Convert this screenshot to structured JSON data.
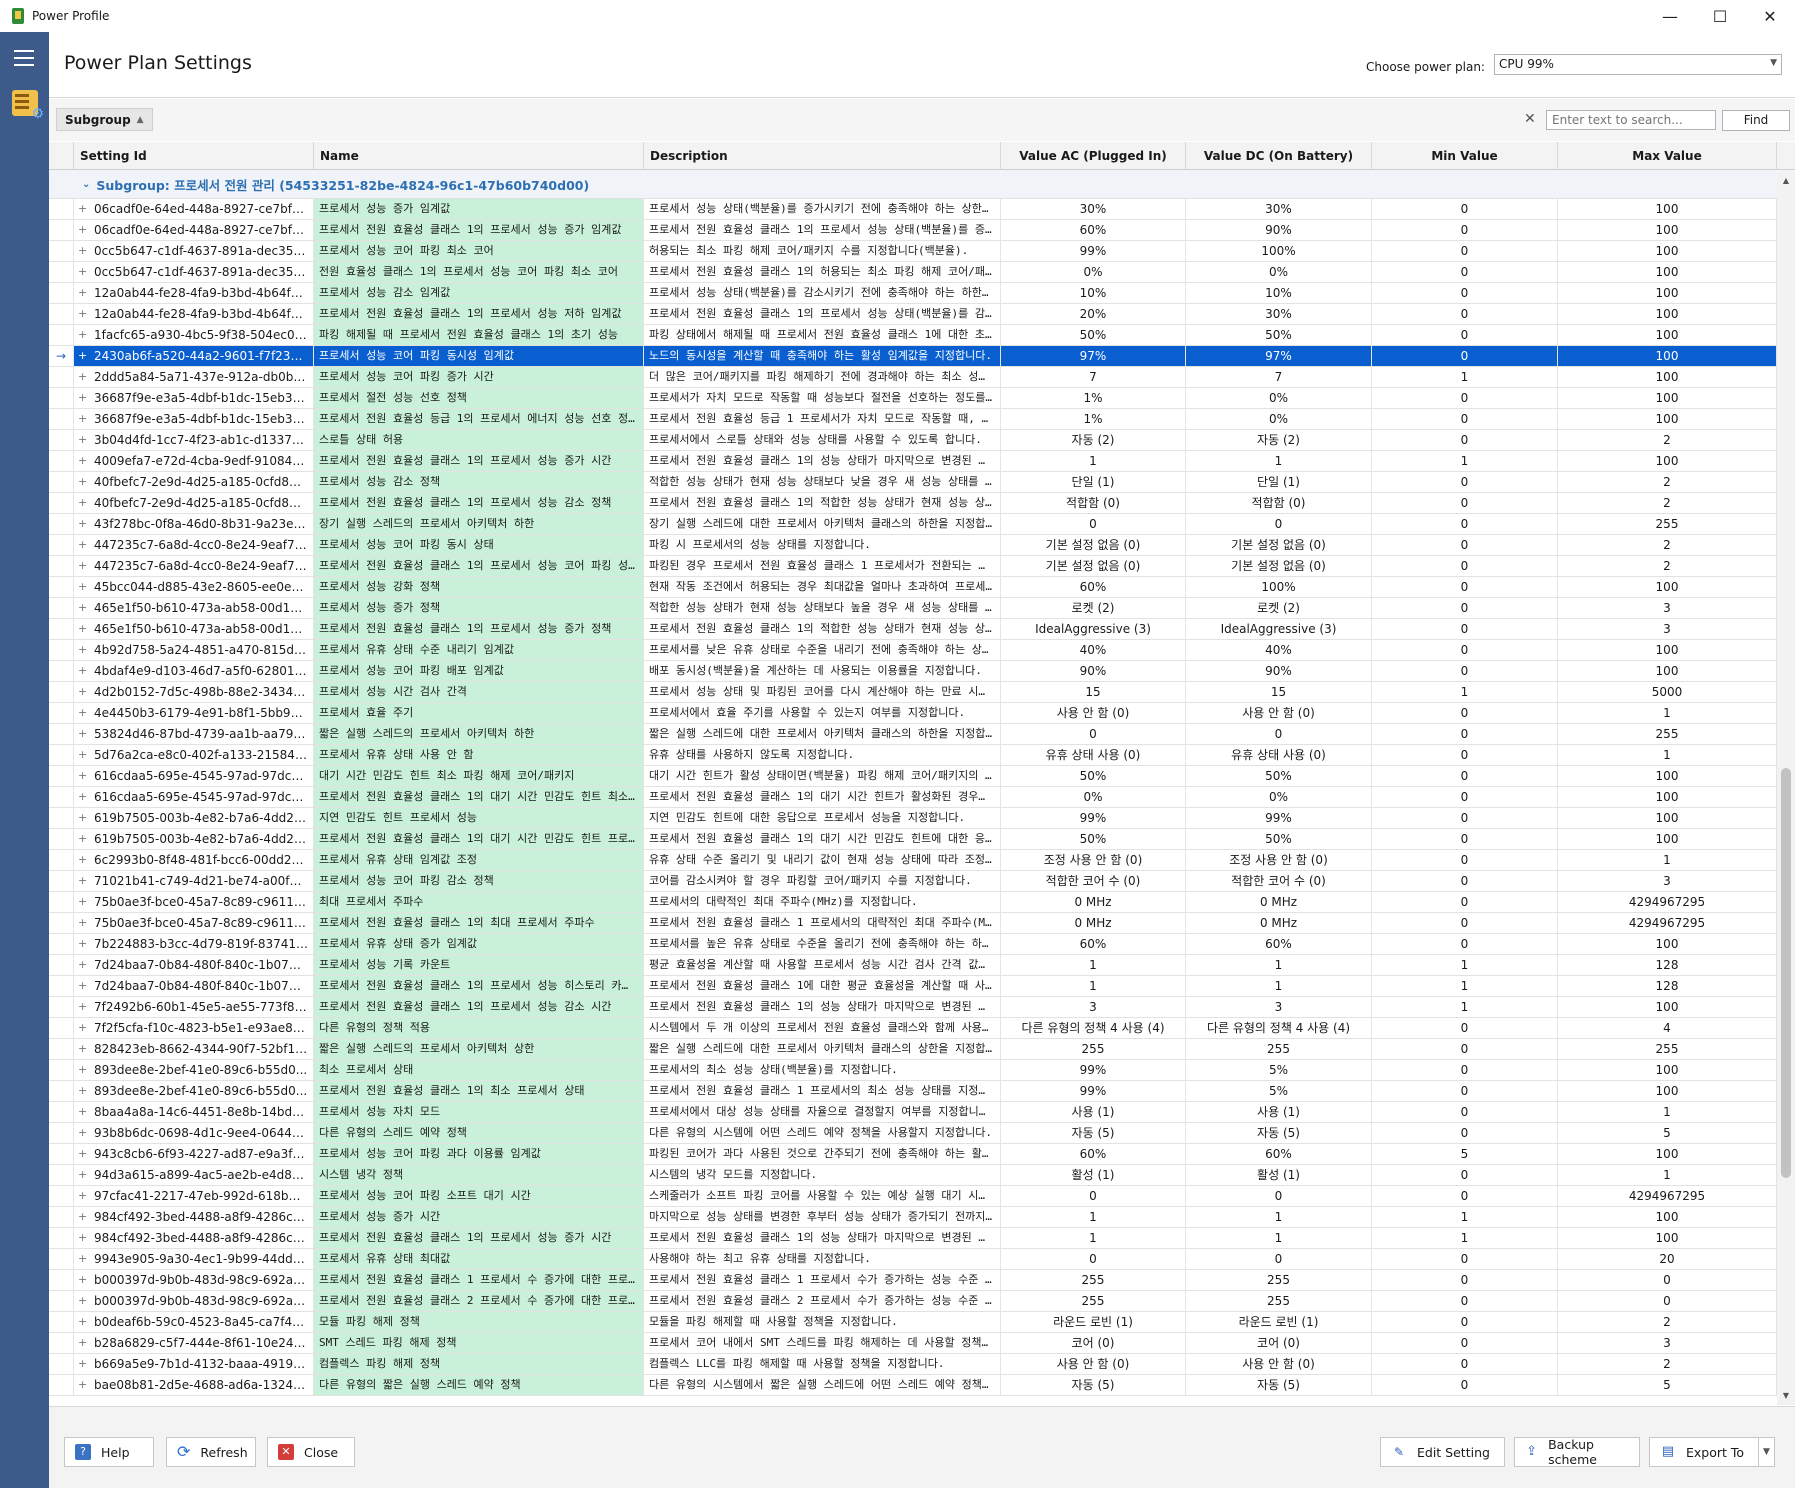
{
  "window": {
    "title": "Power Profile",
    "minimize": "—",
    "maximize": "☐",
    "close": "✕"
  },
  "header": {
    "title": "Power Plan Settings",
    "plan_label": "Choose power plan:",
    "plan_value": "CPU 99%"
  },
  "toolbar": {
    "group_chip": "Subgroup",
    "search_placeholder": "Enter text to search...",
    "find_label": "Find"
  },
  "columns": [
    "Setting Id",
    "Name",
    "Description",
    "Value AC (Plugged In)",
    "Value DC (On Battery)",
    "Min Value",
    "Max Value"
  ],
  "subgroup": "Subgroup: 프로세서 전원 관리 (54533251-82be-4824-96c1-47b60b740d00)",
  "rows": [
    {
      "id": "06cadf0e-64ed-448a-8927-ce7bf9...",
      "name": "프로세서 성능 증가 임계값",
      "desc": "프로세서 성능 상태(백분율)를 증가시키기 전에 충족해야 하는 상한 활성...",
      "ac": "30%",
      "dc": "30%",
      "min": "0",
      "max": "100"
    },
    {
      "id": "06cadf0e-64ed-448a-8927-ce7bf9...",
      "name": "프로세서 전원 효율성 클래스 1의 프로세서 성능 증가 임계값",
      "desc": "프로세서 전원 효율성 클래스 1의 프로세서 성능 상태(백분율)를 증가시...",
      "ac": "60%",
      "dc": "90%",
      "min": "0",
      "max": "100"
    },
    {
      "id": "0cc5b647-c1df-4637-891a-dec35c...",
      "name": "프로세서 성능 코어 파킹 최소 코어",
      "desc": "허용되는 최소 파킹 해제 코어/패키지 수를 지정합니다(백분율).",
      "ac": "99%",
      "dc": "100%",
      "min": "0",
      "max": "100"
    },
    {
      "id": "0cc5b647-c1df-4637-891a-dec35c...",
      "name": "전원 효율성 클래스 1의 프로세서 성능 코어 파킹 최소 코어",
      "desc": "프로세서 전원 효율성 클래스 1의 허용되는 최소 파킹 해제 코어/패키지 ...",
      "ac": "0%",
      "dc": "0%",
      "min": "0",
      "max": "100"
    },
    {
      "id": "12a0ab44-fe28-4fa9-b3bd-4b64f4...",
      "name": "프로세서 성능 감소 임계값",
      "desc": "프로세서 성능 상태(백분율)를 감소시키기 전에 충족해야 하는 하한 활성...",
      "ac": "10%",
      "dc": "10%",
      "min": "0",
      "max": "100"
    },
    {
      "id": "12a0ab44-fe28-4fa9-b3bd-4b64f4...",
      "name": "프로세서 전원 효율성 클래스 1의 프로세서 성능 저하 임계값",
      "desc": "프로세서 전원 효율성 클래스 1의 프로세서 성능 상태(백분율)를 감소시...",
      "ac": "20%",
      "dc": "30%",
      "min": "0",
      "max": "100"
    },
    {
      "id": "1facfc65-a930-4bc5-9f38-504ec09...",
      "name": "파킹 해제될 때 프로세서 전원 효율성 클래스 1의 초기 성능",
      "desc": "파킹 상태에서 해제될 때 프로세서 전원 효율성 클래스 1에 대한 초기 성...",
      "ac": "50%",
      "dc": "50%",
      "min": "0",
      "max": "100"
    },
    {
      "id": "2430ab6f-a520-44a2-9601-f7f23b...",
      "name": "프로세서 성능 코어 파킹 동시성 임계값",
      "desc": "노드의 동시성을 계산할 때 충족해야 하는 활성 임계값을 지정합니다.",
      "ac": "97%",
      "dc": "97%",
      "min": "0",
      "max": "100",
      "selected": true
    },
    {
      "id": "2ddd5a84-5a71-437e-912a-db0b8c...",
      "name": "프로세서 성능 코어 파킹 증가 시간",
      "desc": "더 많은 코어/패키지를 파킹 해제하기 전에 경과해야 하는 최소 성능 검...",
      "ac": "7",
      "dc": "7",
      "min": "1",
      "max": "100"
    },
    {
      "id": "36687f9e-e3a5-4dbf-b1dc-15eb38...",
      "name": "프로세서 절전 성능 선호 정책",
      "desc": "프로세서가 자치 모드로 작동할 때 성능보다 절전을 선호하는 정도를 지...",
      "ac": "1%",
      "dc": "0%",
      "min": "0",
      "max": "100"
    },
    {
      "id": "36687f9e-e3a5-4dbf-b1dc-15eb38...",
      "name": "프로세서 전원 효율성 등급 1의 프로세서 에너지 성능 선호 정책",
      "desc": "프로세서 전원 효율성 등급 1 프로세서가 자치 모드로 작동할 때, 성능보...",
      "ac": "1%",
      "dc": "0%",
      "min": "0",
      "max": "100"
    },
    {
      "id": "3b04d4fd-1cc7-4f23-ab1c-d13378...",
      "name": "스로틀 상태 허용",
      "desc": "프로세서에서 스로틀 상태와 성능 상태를 사용할 수 있도록 합니다.",
      "ac": "자동 (2)",
      "dc": "자동 (2)",
      "min": "0",
      "max": "2"
    },
    {
      "id": "4009efa7-e72d-4cba-9edf-91084e...",
      "name": "프로세서 전원 효율성 클래스 1의 프로세서 성능 증가 시간",
      "desc": "프로세서 전원 효율성 클래스 1의 성능 상태가 마지막으로 변경된 후부터...",
      "ac": "1",
      "dc": "1",
      "min": "1",
      "max": "100"
    },
    {
      "id": "40fbefc7-2e9d-4d25-a185-0cfd85...",
      "name": "프로세서 성능 감소 정책",
      "desc": "적합한 성능 상태가 현재 성능 상태보다 낮을 경우 새 성능 상태를 선택...",
      "ac": "단일 (1)",
      "dc": "단일 (1)",
      "min": "0",
      "max": "2"
    },
    {
      "id": "40fbefc7-2e9d-4d25-a185-0cfd85...",
      "name": "프로세서 전원 효율성 클래스 1의 프로세서 성능 감소 정책",
      "desc": "프로세서 전원 효율성 클래스 1의 적합한 성능 상태가 현재 성능 상태보...",
      "ac": "적합함 (0)",
      "dc": "적합함 (0)",
      "min": "0",
      "max": "2"
    },
    {
      "id": "43f278bc-0f8a-46d0-8b31-9a23e6...",
      "name": "장기 실행 스레드의 프로세서 아키텍처 하한",
      "desc": "장기 실행 스레드에 대한 프로세서 아키텍처 클래스의 하한을 지정합니다.",
      "ac": "0",
      "dc": "0",
      "min": "0",
      "max": "255"
    },
    {
      "id": "447235c7-6a8d-4cc0-8e24-9eaf70...",
      "name": "프로세서 성능 코어 파킹 동시 상태",
      "desc": "파킹 시 프로세서의 성능 상태를 지정합니다.",
      "ac": "기본 설정 없음 (0)",
      "dc": "기본 설정 없음 (0)",
      "min": "0",
      "max": "2"
    },
    {
      "id": "447235c7-6a8d-4cc0-8e24-9eaf70...",
      "name": "프로세서 전원 효율성 클래스 1의 프로세서 성능 코어 파킹 성능 상태",
      "desc": "파킹된 경우 프로세서 전원 효율성 클래스 1 프로세서가 전환되는 성능 ...",
      "ac": "기본 설정 없음 (0)",
      "dc": "기본 설정 없음 (0)",
      "min": "0",
      "max": "2"
    },
    {
      "id": "45bcc044-d885-43e2-8605-ee0ec...",
      "name": "프로세서 성능 강화 정책",
      "desc": "현재 작동 조건에서 허용되는 경우 최대값을 얼마나 초과하여 프로세서의...",
      "ac": "60%",
      "dc": "100%",
      "min": "0",
      "max": "100"
    },
    {
      "id": "465e1f50-b610-473a-ab58-00d107...",
      "name": "프로세서 성능 증가 정책",
      "desc": "적합한 성능 상태가 현재 성능 상태보다 높을 경우 새 성능 상태를 선택...",
      "ac": "로켓 (2)",
      "dc": "로켓 (2)",
      "min": "0",
      "max": "3"
    },
    {
      "id": "465e1f50-b610-473a-ab58-00d107...",
      "name": "프로세서 전원 효율성 클래스 1의 프로세서 성능 증가 정책",
      "desc": "프로세서 전원 효율성 클래스 1의 적합한 성능 상태가 현재 성능 상태보...",
      "ac": "IdealAggressive (3)",
      "dc": "IdealAggressive (3)",
      "min": "0",
      "max": "3"
    },
    {
      "id": "4b92d758-5a24-4851-a470-815d7...",
      "name": "프로세서 유휴 상태 수준 내리기 임계값",
      "desc": "프로세서를 낮은 유휴 상태로 수준을 내리기 전에 충족해야 하는 상한 활...",
      "ac": "40%",
      "dc": "40%",
      "min": "0",
      "max": "100"
    },
    {
      "id": "4bdaf4e9-d103-46d7-a5f0-628012...",
      "name": "프로세서 성능 코어 파킹 배포 임계값",
      "desc": "배포 동시성(백분율)을 계산하는 데 사용되는 이용률을 지정합니다.",
      "ac": "90%",
      "dc": "90%",
      "min": "0",
      "max": "100"
    },
    {
      "id": "4d2b0152-7d5c-498b-88e2-34345...",
      "name": "프로세서 성능 시간 검사 간격",
      "desc": "프로세서 성능 상태 및 파킹된 코어를 다시 계산해야 하는 만료 시간(밀...",
      "ac": "15",
      "dc": "15",
      "min": "1",
      "max": "5000"
    },
    {
      "id": "4e4450b3-6179-4e91-b8f1-5bb99...",
      "name": "프로세서 효율 주기",
      "desc": "프로세서에서 효율 주기를 사용할 수 있는지 여부를 지정합니다.",
      "ac": "사용 안 함 (0)",
      "dc": "사용 안 함 (0)",
      "min": "0",
      "max": "1"
    },
    {
      "id": "53824d46-87bd-4739-aa1b-aa793f...",
      "name": "짧은 실행 스레드의 프로세서 아키텍처 하한",
      "desc": "짧은 실행 스레드에 대한 프로세서 아키텍처 클래스의 하한을 지정합니다.",
      "ac": "0",
      "dc": "0",
      "min": "0",
      "max": "255"
    },
    {
      "id": "5d76a2ca-e8c0-402f-a133-215849...",
      "name": "프로세서 유휴 상태 사용 안 함",
      "desc": "유휴 상태를 사용하지 않도록 지정합니다.",
      "ac": "유휴 상태 사용 (0)",
      "dc": "유휴 상태 사용 (0)",
      "min": "0",
      "max": "1"
    },
    {
      "id": "616cdaa5-695e-4545-97ad-97dc2d...",
      "name": "대기 시간 민감도 힌트 최소 파킹 해제 코어/패키지",
      "desc": "대기 시간 힌트가 활성 상태이면(백분율) 파킹 해제 코어/패키지의 최소 ...",
      "ac": "50%",
      "dc": "50%",
      "min": "0",
      "max": "100"
    },
    {
      "id": "616cdaa5-695e-4545-97ad-97dc2d...",
      "name": "프로세서 전원 효율성 클래스 1의 대기 시간 민감도 힌트 최소 파...",
      "desc": "프로세서 전원 효율성 클래스 1의 대기 시간 힌트가 활성화된 경우에 최...",
      "ac": "0%",
      "dc": "0%",
      "min": "0",
      "max": "100"
    },
    {
      "id": "619b7505-003b-4e82-b7a6-4dd29...",
      "name": "지연 민감도 힌트 프로세서 성능",
      "desc": "지연 민감도 힌트에 대한 응답으로 프로세서 성능을 지정합니다.",
      "ac": "99%",
      "dc": "99%",
      "min": "0",
      "max": "100"
    },
    {
      "id": "619b7505-003b-4e82-b7a6-4dd29...",
      "name": "프로세서 전원 효율성 클래스 1의 대기 시간 민감도 힌트 프로세서...",
      "desc": "프로세서 전원 효율성 클래스 1의 대기 시간 민감도 힌트에 대한 응답으...",
      "ac": "50%",
      "dc": "50%",
      "min": "0",
      "max": "100"
    },
    {
      "id": "6c2993b0-8f48-481f-bcc6-00dd27...",
      "name": "프로세서 유휴 상태 임계값 조정",
      "desc": "유휴 상태 수준 올리기 및 내리기 값이 현재 성능 상태에 따라 조정되도...",
      "ac": "조정 사용 안 함 (0)",
      "dc": "조정 사용 안 함 (0)",
      "min": "0",
      "max": "1"
    },
    {
      "id": "71021b41-c749-4d21-be74-a00f33...",
      "name": "프로세서 성능 코어 파킹 감소 정책",
      "desc": "코어를 감소시켜야 할 경우 파킹할 코어/패키지 수를 지정합니다.",
      "ac": "적합한 코어 수 (0)",
      "dc": "적합한 코어 수 (0)",
      "min": "0",
      "max": "3"
    },
    {
      "id": "75b0ae3f-bce0-45a7-8c89-c9611c...",
      "name": "최대 프로세서 주파수",
      "desc": "프로세서의 대략적인 최대 주파수(MHz)를 지정합니다.",
      "ac": "0 MHz",
      "dc": "0 MHz",
      "min": "0",
      "max": "4294967295"
    },
    {
      "id": "75b0ae3f-bce0-45a7-8c89-c9611c...",
      "name": "프로세서 전원 효율성 클래스 1의 최대 프로세서 주파수",
      "desc": "프로세서 전원 효율성 클래스 1 프로세서의 대략적인 최대 주파수(MHz)...",
      "ac": "0 MHz",
      "dc": "0 MHz",
      "min": "0",
      "max": "4294967295"
    },
    {
      "id": "7b224883-b3cc-4d79-819f-837415...",
      "name": "프로세서 유휴 상태 증가 임계값",
      "desc": "프로세서를 높은 유휴 상태로 수준을 올리기 전에 충족해야 하는 하한 활...",
      "ac": "60%",
      "dc": "60%",
      "min": "0",
      "max": "100"
    },
    {
      "id": "7d24baa7-0b84-480f-840c-1b0743...",
      "name": "프로세서 성능 기록 카운트",
      "desc": "평균 효율성을 계산할 때 사용할 프로세서 성능 시간 검사 간격 값을 지...",
      "ac": "1",
      "dc": "1",
      "min": "1",
      "max": "128"
    },
    {
      "id": "7d24baa7-0b84-480f-840c-1b0743...",
      "name": "프로세서 전원 효율성 클래스 1의 프로세서 성능 히스토리 카운트",
      "desc": "프로세서 전원 효율성 클래스 1에 대한 평균 효율성을 계산할 때 사용할 ...",
      "ac": "1",
      "dc": "1",
      "min": "1",
      "max": "128"
    },
    {
      "id": "7f2492b6-60b1-45e5-ae55-773f8c...",
      "name": "프로세서 전원 효율성 클래스 1의 프로세서 성능 감소 시간",
      "desc": "프로세서 전원 효율성 클래스 1의 성능 상태가 마지막으로 변경된 후부터...",
      "ac": "3",
      "dc": "3",
      "min": "1",
      "max": "100"
    },
    {
      "id": "7f2f5cfa-f10c-4823-b5e1-e93ae85...",
      "name": "다른 유형의 정책 적용",
      "desc": "시스템에서 두 개 이상의 프로세서 전원 효율성 클래스와 함께 사용할 정...",
      "ac": "다른 유형의 정책 4 사용 (4)",
      "dc": "다른 유형의 정책 4 사용 (4)",
      "min": "0",
      "max": "4"
    },
    {
      "id": "828423eb-8662-4344-90f7-52bf15...",
      "name": "짧은 실행 스레드의 프로세서 아키텍처 상한",
      "desc": "짧은 실행 스레드에 대한 프로세서 아키텍처 클래스의 상한을 지정합니다.",
      "ac": "255",
      "dc": "255",
      "min": "0",
      "max": "255"
    },
    {
      "id": "893dee8e-2bef-41e0-89c6-b55d0...",
      "name": "최소 프로세서 상태",
      "desc": "프로세서의 최소 성능 상태(백분율)를 지정합니다.",
      "ac": "99%",
      "dc": "5%",
      "min": "0",
      "max": "100"
    },
    {
      "id": "893dee8e-2bef-41e0-89c6-b55d0...",
      "name": "프로세서 전원 효율성 클래스 1의 최소 프로세서 상태",
      "desc": "프로세서 전원 효율성 클래스 1 프로세서의 최소 성능 상태를 지정합니다...",
      "ac": "99%",
      "dc": "5%",
      "min": "0",
      "max": "100"
    },
    {
      "id": "8baa4a8a-14c6-4451-8e8b-14bdbd...",
      "name": "프로세서 성능 자치 모드",
      "desc": "프로세서에서 대상 성능 상태를 자율으로 결정할지 여부를 지정합니다.",
      "ac": "사용 (1)",
      "dc": "사용 (1)",
      "min": "0",
      "max": "1"
    },
    {
      "id": "93b8b6dc-0698-4d1c-9ee4-0644e...",
      "name": "다른 유형의 스레드 예약 정책",
      "desc": "다른 유형의 시스템에 어떤 스레드 예약 정책을 사용할지 지정합니다.",
      "ac": "자동 (5)",
      "dc": "자동 (5)",
      "min": "0",
      "max": "5"
    },
    {
      "id": "943c8cb6-6f93-4227-ad87-e9a3fe...",
      "name": "프로세서 성능 코어 파킹 과다 이용률 임계값",
      "desc": "파킹된 코어가 과다 사용된 것으로 간주되기 전에 충족해야 하는 활성 임...",
      "ac": "60%",
      "dc": "60%",
      "min": "5",
      "max": "100"
    },
    {
      "id": "94d3a615-a899-4ac5-ae2b-e4d8f6...",
      "name": "시스템 냉각 정책",
      "desc": "시스템의 냉각 모드를 지정합니다.",
      "ac": "활성 (1)",
      "dc": "활성 (1)",
      "min": "0",
      "max": "1"
    },
    {
      "id": "97cfac41-2217-47eb-992d-618b19...",
      "name": "프로세서 성능 코어 파킹 소프트 대기 시간",
      "desc": "스케줄러가 소프트 파킹 코어를 사용할 수 있는 예상 실행 대기 시간을 ...",
      "ac": "0",
      "dc": "0",
      "min": "0",
      "max": "4294967295"
    },
    {
      "id": "984cf492-3bed-4488-a8f9-4286c9...",
      "name": "프로세서 성능 증가 시간",
      "desc": "마지막으로 성능 상태를 변경한 후부터 성능 상태가 증가되기 전까지 최...",
      "ac": "1",
      "dc": "1",
      "min": "1",
      "max": "100"
    },
    {
      "id": "984cf492-3bed-4488-a8f9-4286c9...",
      "name": "프로세서 전원 효율성 클래스 1의 프로세서 성능 증가 시간",
      "desc": "프로세서 전원 효율성 클래스 1의 성능 상태가 마지막으로 변경된 후부터...",
      "ac": "1",
      "dc": "1",
      "min": "1",
      "max": "100"
    },
    {
      "id": "9943e905-9a30-4ec1-9b99-44dd3...",
      "name": "프로세서 유휴 상태 최대값",
      "desc": "사용해야 하는 최고 유휴 상태를 지정합니다.",
      "ac": "0",
      "dc": "0",
      "min": "0",
      "max": "20"
    },
    {
      "id": "b000397d-9b0b-483d-98c9-692a6...",
      "name": "프로세서 전원 효율성 클래스 1 프로세서 수 증가에 대한 프로세서...",
      "desc": "프로세서 전원 효율성 클래스 1 프로세서 수가 증가하는 성능 수준 증가 ...",
      "ac": "255",
      "dc": "255",
      "min": "0",
      "max": "0"
    },
    {
      "id": "b000397d-9b0b-483d-98c9-692a6...",
      "name": "프로세서 전원 효율성 클래스 2 프로세서 수 증가에 대한 프로세서...",
      "desc": "프로세서 전원 효율성 클래스 2 프로세서 수가 증가하는 성능 수준 증가 ...",
      "ac": "255",
      "dc": "255",
      "min": "0",
      "max": "0"
    },
    {
      "id": "b0deaf6b-59c0-4523-8a45-ca7f40...",
      "name": "모듈 파킹 해제 정책",
      "desc": "모듈을 파킹 해제할 때 사용할 정책을 지정합니다.",
      "ac": "라운드 로빈 (1)",
      "dc": "라운드 로빈 (1)",
      "min": "0",
      "max": "2"
    },
    {
      "id": "b28a6829-c5f7-444e-8f61-10e24e...",
      "name": "SMT 스레드 파킹 해제 정책",
      "desc": "프로세서 코어 내에서 SMT 스레드를 파킹 해제하는 데 사용할 정책을 ...",
      "ac": "코어 (0)",
      "dc": "코어 (0)",
      "min": "0",
      "max": "3"
    },
    {
      "id": "b669a5e9-7b1d-4132-baaa-49190a...",
      "name": "컴플렉스 파킹 해제 정책",
      "desc": "컴플렉스 LLC를 파킹 해제할 때 사용할 정책을 지정합니다.",
      "ac": "사용 안 함 (0)",
      "dc": "사용 안 함 (0)",
      "min": "0",
      "max": "2"
    },
    {
      "id": "bae08b81-2d5e-4688-ad6a-13243...",
      "name": "다른 유형의 짧은 실행 스레드 예약 정책",
      "desc": "다른 유형의 시스템에서 짧은 실행 스레드에 어떤 스레드 예약 정책을 사...",
      "ac": "자동 (5)",
      "dc": "자동 (5)",
      "min": "0",
      "max": "5"
    }
  ],
  "footer": {
    "help": "Help",
    "refresh": "Refresh",
    "close": "Close",
    "edit_setting": "Edit Setting",
    "backup_scheme": "Backup scheme",
    "export_to": "Export To"
  }
}
